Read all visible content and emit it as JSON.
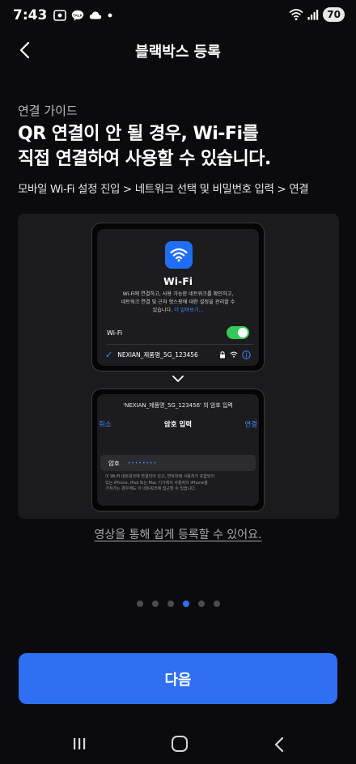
{
  "status_bar": {
    "time": "7:43",
    "battery": "70",
    "left_icons": [
      "screen-record-icon",
      "kakaotalk-icon",
      "cloud-icon",
      "notification-dot-icon"
    ],
    "right_icons": [
      "wifi-signal-icon",
      "cell-signal-icon",
      "battery-icon"
    ]
  },
  "header": {
    "title": "블랙박스 등록"
  },
  "guide": {
    "label": "연결 가이드",
    "headline_line1": "QR 연결이 안 될 경우, Wi-Fi를",
    "headline_line2": "직접 연결하여 사용할 수 있습니다.",
    "steps": "모바일 Wi-Fi 설정 진입 > 네트워크 선택 및 비밀번호 입력 > 연결"
  },
  "illustration": {
    "wifi_screen": {
      "title": "Wi-Fi",
      "desc_line1": "Wi-Fi에 연결하고, 사용 가능한 네트워크를 확인하고,",
      "desc_line2": "네트워크 연결 및 근처 핫스팟에 대한 설정을 관리할 수",
      "desc_line3": "있습니다.",
      "more_link": "더 알아보기...",
      "toggle_label": "Wi-Fi",
      "toggle_on": true,
      "network_name": "NEXIAN_제품명_5G_123456"
    },
    "password_screen": {
      "top_title": "'NEXIAN_제품명_5G_123456' 의 암호 입력",
      "cancel": "취소",
      "heading": "암호 입력",
      "join": "연결",
      "field_label": "암호",
      "field_value": "••••••••",
      "note_line1": "이 Wi-Fi 네트워크에 연결되어 있고, 연락처에 사용자가 포함되어",
      "note_line2": "있는 iPhone, iPad 또는 Mac 기기에서 사용자의 iPhone을",
      "note_line3": "가져가는 경우에도 이 네트워크에 접근할 수 있습니다."
    }
  },
  "video_link": "영상을 통해 쉽게 등록할 수 있어요.",
  "pager": {
    "total": 6,
    "current": 4
  },
  "next_button": "다음",
  "colors": {
    "background": "#0b0b0d",
    "card": "#1b1b1e",
    "accent": "#2f6ff2",
    "toggle_on": "#32c95a",
    "link_blue": "#3f8cff"
  }
}
